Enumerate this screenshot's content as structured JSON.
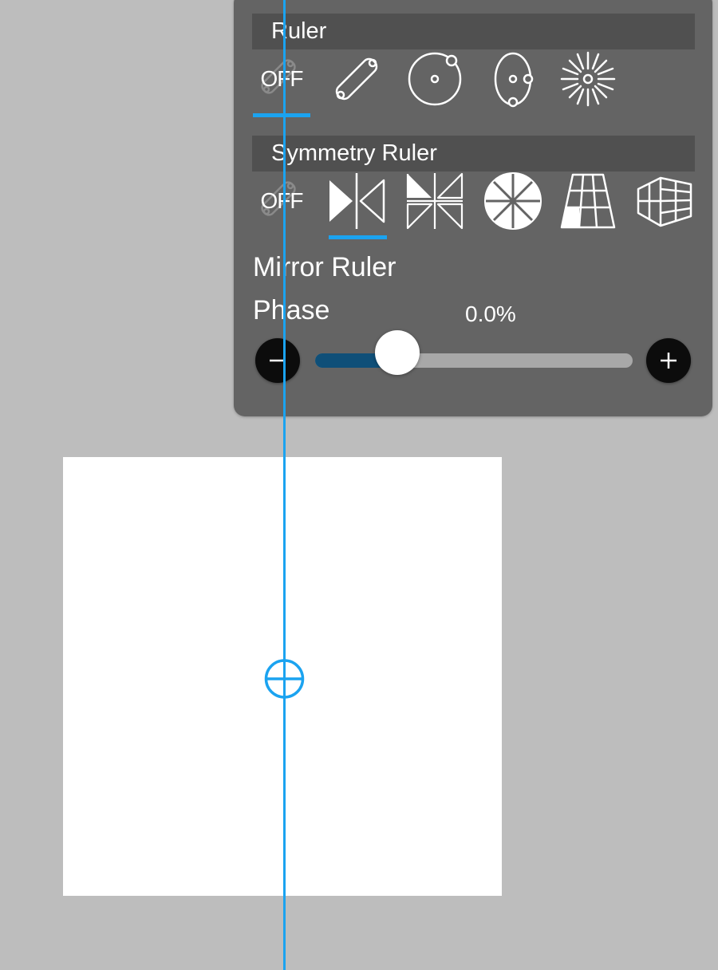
{
  "ruler": {
    "header": "Ruler",
    "off_label": "OFF",
    "tools": [
      {
        "icon": "off-icon",
        "selected": true
      },
      {
        "icon": "straight-ruler-icon",
        "selected": false
      },
      {
        "icon": "circle-ruler-icon",
        "selected": false
      },
      {
        "icon": "ellipse-ruler-icon",
        "selected": false
      },
      {
        "icon": "radial-ruler-icon",
        "selected": false
      }
    ]
  },
  "symmetry": {
    "header": "Symmetry Ruler",
    "off_label": "OFF",
    "tools": [
      {
        "icon": "off-icon",
        "selected": false
      },
      {
        "icon": "mirror-ruler-icon",
        "selected": true
      },
      {
        "icon": "kaleidoscope-ruler-icon",
        "selected": false
      },
      {
        "icon": "radial-symmetry-icon",
        "selected": false
      },
      {
        "icon": "perspective-grid-icon",
        "selected": false
      },
      {
        "icon": "3d-perspective-icon",
        "selected": false
      }
    ]
  },
  "mode_label": "Mirror Ruler",
  "phase": {
    "label": "Phase",
    "value_text": "0.0%",
    "slider_fraction": 0.26
  },
  "colors": {
    "accent": "#1ba3f0",
    "panel": "#646464",
    "header": "#505050",
    "slider_fill": "#0f4f78",
    "slider_track": "#a8a8a8",
    "background": "#bdbdbd"
  }
}
